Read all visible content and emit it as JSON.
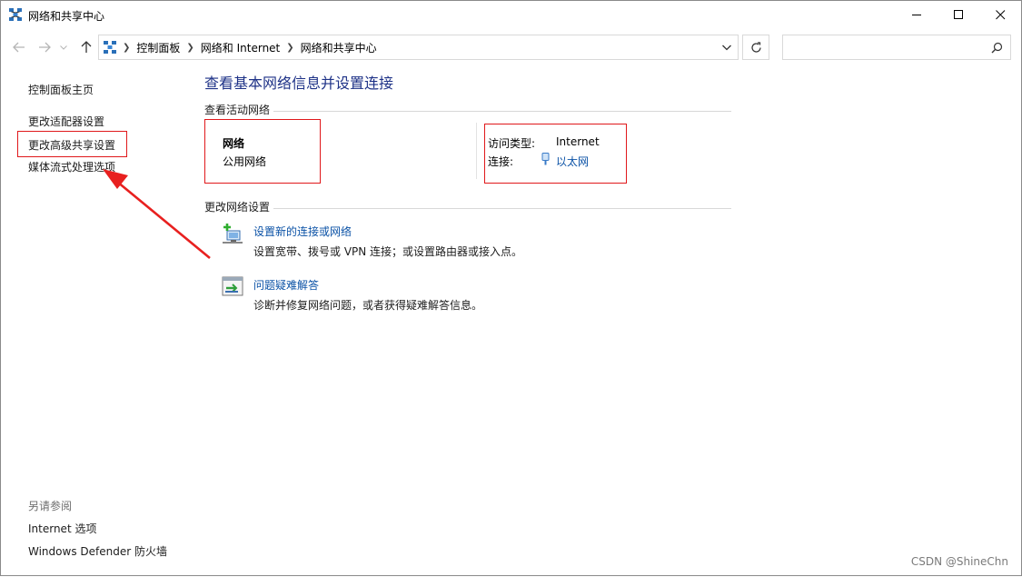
{
  "window": {
    "title": "网络和共享中心"
  },
  "address_bar": {
    "crumbs": [
      "控制面板",
      "网络和 Internet",
      "网络和共享中心"
    ],
    "search_placeholder": ""
  },
  "sidebar": {
    "home": "控制面板主页",
    "links": [
      "更改适配器设置",
      "更改高级共享设置",
      "媒体流式处理选项"
    ],
    "see_also_title": "另请参阅",
    "see_also": [
      "Internet 选项",
      "Windows Defender 防火墙"
    ]
  },
  "main": {
    "heading": "查看基本网络信息并设置连接",
    "active_section": "查看活动网络",
    "network": {
      "name": "网络",
      "category": "公用网络",
      "access_type_label": "访问类型:",
      "access_type_value": "Internet",
      "connection_label": "连接:",
      "connection_value": "以太网"
    },
    "change_section": "更改网络设置",
    "tasks": [
      {
        "title": "设置新的连接或网络",
        "desc": "设置宽带、拨号或 VPN 连接；或设置路由器或接入点。",
        "icon": "network-setup-icon"
      },
      {
        "title": "问题疑难解答",
        "desc": "诊断并修复网络问题，或者获得疑难解答信息。",
        "icon": "troubleshoot-icon"
      }
    ]
  },
  "watermark": "CSDN @ShineChn",
  "colors": {
    "link": "#0b52a6",
    "heading": "#1e3287",
    "highlight": "#e0181b"
  }
}
